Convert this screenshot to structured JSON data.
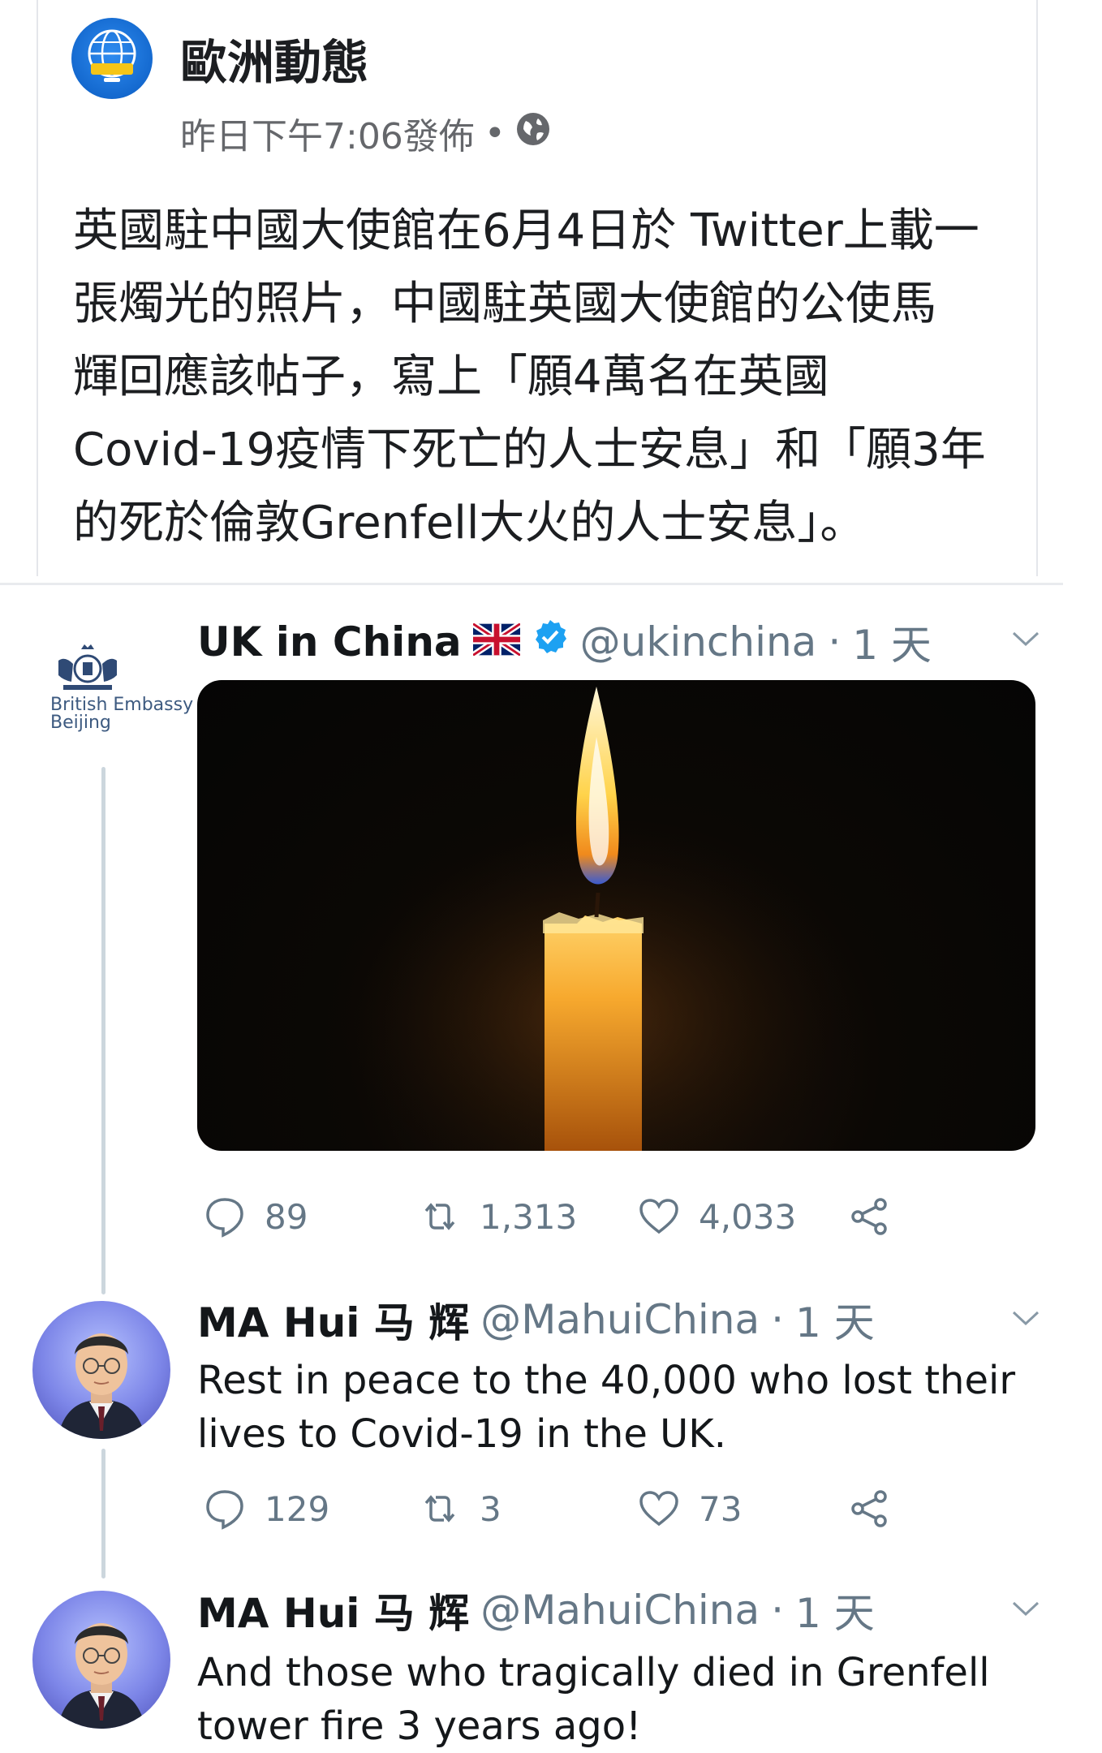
{
  "fb_post": {
    "page_name": "歐洲動態",
    "timestamp": "昨日下午7:06發佈",
    "dot": "•",
    "body_lines": [
      "英國駐中國大使館在6月4日於 Twitter上載一",
      "張燭光的照片，中國駐英國大使館的公使馬",
      "輝回應該帖子，寫上「願4萬名在英國",
      "Covid-19疫情下死亡的人士安息」和「願3年",
      "的死於倫敦Grenfell大火的人士安息」。"
    ]
  },
  "tweets": [
    {
      "name": "UK in China",
      "flag": "🇬🇧",
      "handle": "@ukinchina",
      "time": "1 天",
      "avatar_text": [
        "British Embassy",
        "Beijing"
      ],
      "text_lines": [],
      "replies": "89",
      "retweets": "1,313",
      "likes": "4,033"
    },
    {
      "name": "MA Hui 马 辉",
      "handle": "@MahuiChina",
      "time": "1 天",
      "text_lines": [
        "Rest in peace to the 40,000 who lost their",
        "lives to Covid-19 in the UK."
      ],
      "replies": "129",
      "retweets": "3",
      "likes": "73"
    },
    {
      "name": "MA Hui 马 辉",
      "handle": "@MahuiChina",
      "time": "1 天",
      "text_lines": [
        "And those who tragically died in Grenfell",
        "tower fire 3 years ago!"
      ]
    }
  ],
  "colors": {
    "verified": "#1da1f2",
    "secondary_text": "#657786",
    "thread_line": "#ccd6dd"
  },
  "icons": [
    "globe-icon",
    "verified-badge-icon",
    "chevron-down-icon",
    "reply-icon",
    "retweet-icon",
    "like-icon",
    "share-icon"
  ]
}
